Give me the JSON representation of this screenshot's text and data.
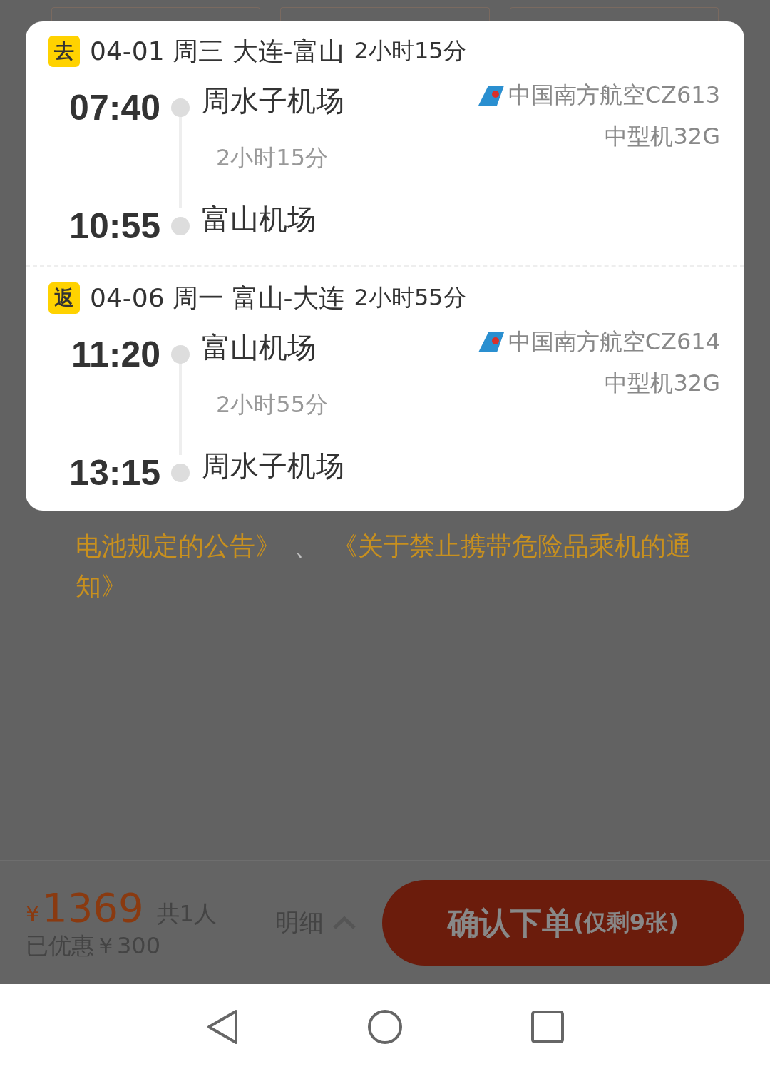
{
  "legs": [
    {
      "tag": "去",
      "date": "04-01",
      "weekday": "周三",
      "route": "大连-富山",
      "duration": "2小时15分",
      "depart_time": "07:40",
      "depart_airport": "周水子机场",
      "airline": "中国南方航空CZ613",
      "aircraft": "中型机32G",
      "flight_duration": "2小时15分",
      "arrive_time": "10:55",
      "arrive_airport": "富山机场"
    },
    {
      "tag": "返",
      "date": "04-06",
      "weekday": "周一",
      "route": "富山-大连",
      "duration": "2小时55分",
      "depart_time": "11:20",
      "depart_airport": "富山机场",
      "airline": "中国南方航空CZ614",
      "aircraft": "中型机32G",
      "flight_duration": "2小时55分",
      "arrive_time": "13:15",
      "arrive_airport": "周水子机场"
    }
  ],
  "notice": {
    "link_1": "电池规定的公告》",
    "separator": "、",
    "link_2_line_1": "《关于禁止携带危险品乘机的通",
    "link_2_line_2": "知》"
  },
  "footer": {
    "currency": "¥",
    "price": "1369",
    "travellers": "共1人",
    "discount": "已优惠￥300",
    "details": "明细",
    "details_expanded": true,
    "confirm": "确认下单",
    "remaining": "(仅剩9张)"
  }
}
